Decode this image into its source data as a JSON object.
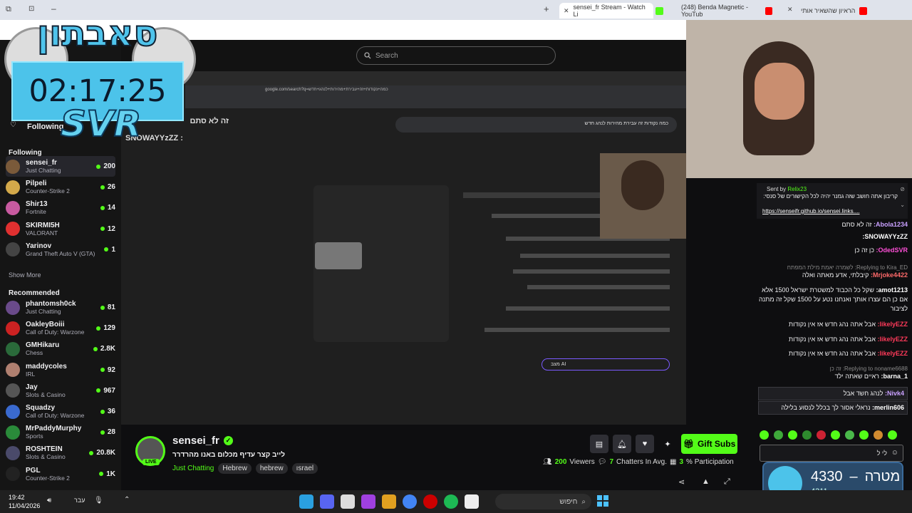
{
  "browser": {
    "tabs": [
      {
        "label": "sensei_fr Stream - Watch Li",
        "color": "#53fc18",
        "active": true
      },
      {
        "label": "(248) Benda Magnetic - YouTub",
        "color": "#ff0000"
      },
      {
        "label": "הראיון שהשאיר אותי",
        "color": "#ff0000"
      }
    ]
  },
  "site": {
    "search_placeholder": "Search"
  },
  "overlay": {
    "timer": "02:17:25",
    "brand": "סאבתון",
    "svr": "SVR",
    "goal_current": "4330",
    "goal_label": "מטרה",
    "goal_sub": "4311"
  },
  "sidebar": {
    "following_btn": "Following",
    "following_header": "Following",
    "show_more": "Show More",
    "recommended_header": "Recommended",
    "following": [
      {
        "name": "sensei_fr",
        "category": "Just Chatting",
        "viewers": "200",
        "color": "#7a5a3a"
      },
      {
        "name": "Pilpeli",
        "category": "Counter-Strike 2",
        "viewers": "26",
        "color": "#d4a94a"
      },
      {
        "name": "Shir13",
        "category": "Fortnite",
        "viewers": "14",
        "color": "#c85aa0"
      },
      {
        "name": "SKIRMI5H",
        "category": "VALORANT",
        "viewers": "12",
        "color": "#e03030"
      },
      {
        "name": "Yarinov",
        "category": "Grand Theft Auto V (GTA)",
        "viewers": "1",
        "color": "#444"
      }
    ],
    "recommended": [
      {
        "name": "phantomsh0ck",
        "category": "Just Chatting",
        "viewers": "81",
        "color": "#6a4a8a"
      },
      {
        "name": "OakleyBoiii",
        "category": "Call of Duty: Warzone",
        "viewers": "129",
        "color": "#c22"
      },
      {
        "name": "GMHikaru",
        "category": "Chess",
        "viewers": "2.8K",
        "color": "#2a6a3a"
      },
      {
        "name": "maddycoles",
        "category": "IRL",
        "viewers": "92",
        "color": "#b08070"
      },
      {
        "name": "Jay",
        "category": "Slots & Casino",
        "viewers": "967",
        "color": "#555"
      },
      {
        "name": "Squadzy",
        "category": "Call of Duty: Warzone",
        "viewers": "36",
        "color": "#3a6ad0"
      },
      {
        "name": "MrPaddyMurphy",
        "category": "Sports",
        "viewers": "28",
        "color": "#2a8a3a"
      },
      {
        "name": "ROSHTEIN",
        "category": "Slots & Casino",
        "viewers": "20.8K",
        "color": "#4a4a6a"
      },
      {
        "name": "PGL",
        "category": "Counter-Strike 2",
        "viewers": "1K",
        "color": "#222"
      }
    ]
  },
  "stream_info": {
    "channel": "sensei_fr",
    "live_badge": "LIVE",
    "title": "לייב קצר עדיף מכלום באנו מהרדרר",
    "category": "Just Chatting",
    "tags": [
      "Hebrew",
      "hebrew",
      "ısrael"
    ],
    "gift_subs": "Gift Subs",
    "viewers": "200",
    "viewers_label": "Viewers",
    "chatters": "7",
    "chatters_label": "Chatters In Avg.",
    "participation": "3",
    "participation_label": "% Participation"
  },
  "video": {
    "chat_overlay": [
      "זה לא סתם",
      "SNOWAYYzZZ :"
    ],
    "google_query": "כמה נקודות זה עבירת מהירות לנהג חדש",
    "google_url": "google.com/search?q=כמה+נקודות+זה+עבירת+מהירות+לנהג+חדש",
    "ai_button": "מצב AI"
  },
  "chat": {
    "pinned_sent_by": "Sent by",
    "pinned_user": "Relix23",
    "pinned_text": "קריבון אתה חושב שזה גמנר יהיה לכל הקישורים של סנסי:",
    "pinned_link": "https://senseifr.github.io/sensei.links....",
    "messages": [
      {
        "user": "Abola1234",
        "text": "זה לא סתם",
        "color": "#c9a0ff"
      },
      {
        "user": "SNOWAYYzZZ",
        "text": "",
        "color": "#ffffff"
      },
      {
        "user": "OdedSVR",
        "text": "כן זה כן",
        "color": "#ff4fd8"
      },
      {
        "reply": "Replying to Kira_ED: לשמרה יאמת מילת המפתח"
      },
      {
        "user": "Mrjoke4422",
        "text": "קיבלתי, אדע מאתה ואלה",
        "color": "#ff6a6a"
      },
      {
        "user": "amot1213",
        "text": "שקל כל הכבוד למשטרת ישראל 1500 אלא אם כן הם עצרו אותך ואנחנו נטע על 1500 שקל זה מתנה לציבור",
        "color": "#ffffff"
      },
      {
        "user": "likelyEZZ",
        "text": "אבל אתה נהג חדש אז אין נקודות",
        "color": "#ff3a5a"
      },
      {
        "user": "likelyEZZ",
        "text": "אבל אתה נהג חדש אז אין נקודות",
        "color": "#ff3a5a"
      },
      {
        "user": "likelyEZZ",
        "text": "אבל אתה נהג חדש אז אין נקודות",
        "color": "#ff3a5a"
      },
      {
        "reply": "Replying to noname6688: זה כן"
      },
      {
        "user": "barna_1",
        "text": "ראיים שאתה ילד",
        "color": "#ffffff"
      },
      {
        "user": "Nivk4",
        "text": "לנהג חשד אבל",
        "color": "#c9a0ff"
      },
      {
        "user": "merlin606",
        "text": "נראלי אסור לך בכלל לנסוע בלילה",
        "color": "#ffffff"
      }
    ],
    "input_text": "לי ל"
  },
  "taskbar": {
    "time": "19:42",
    "date": "11/04/2026",
    "lang": "עבר",
    "search": "חיפוש"
  }
}
